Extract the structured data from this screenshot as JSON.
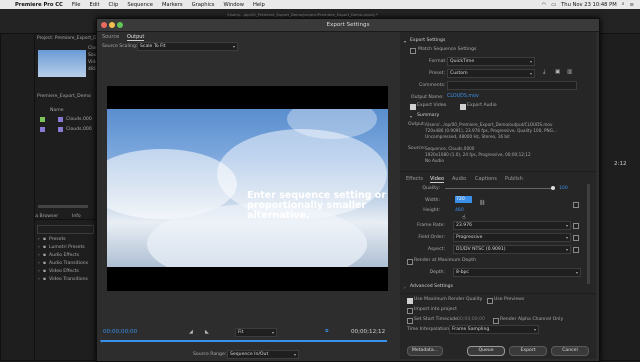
{
  "menubar": {
    "app": "Premiere Pro CC",
    "items": [
      "File",
      "Edit",
      "Clip",
      "Sequence",
      "Markers",
      "Graphics",
      "Window",
      "Help"
    ],
    "clock": "Thu Nov 23  10:48 PM"
  },
  "background_app": {
    "project_label": "Project: Premiere_Export_Demo",
    "clip_name": "Clouds",
    "clip_meta_1": "Sourc",
    "clip_meta_2": "Video",
    "clip_meta_3": "480",
    "project_file": "Premiere_Export_Demo",
    "name_header": "Name",
    "item1": "Clouds.000",
    "item2": "Clouds.000",
    "effects_tabs": [
      "ia Browser",
      "Info"
    ],
    "effects_items": [
      "Presets",
      "Lumetri Presets",
      "Audio Effects",
      "Audio Transitions",
      "Video Effects",
      "Video Transitions"
    ],
    "right_time": "2:12"
  },
  "dialog": {
    "title": "Export Settings",
    "path_hint": "/Users/...Jop/00_Premiere_Export_Demo/project/Premiere_Export_Demo.prproj *",
    "source_tab": "Source",
    "output_tab": "Output",
    "source_scaling_label": "Source Scaling:",
    "source_scaling_value": "Scale To Fit",
    "overlay_text": "Enter sequence setting or proportionally smaller alternative.",
    "timecode_start": "00;00;00;00",
    "timecode_end": "00;00;12;12",
    "fit_label": "Fit",
    "source_range_label": "Source Range:",
    "source_range_value": "Sequence In/Out",
    "metadata_button": "Metadata...",
    "queue_button": "Queue",
    "export_button": "Export",
    "cancel_button": "Cancel"
  },
  "export_settings": {
    "header": "Export Settings",
    "match_sequence": "Match Sequence Settings",
    "format_label": "Format:",
    "format_value": "QuickTime",
    "preset_label": "Preset:",
    "preset_value": "Custom",
    "comments_label": "Comments:",
    "output_name_label": "Output Name:",
    "output_name_value": "CLOUDS.mov",
    "export_video": "Export Video",
    "export_audio": "Export Audio",
    "summary_header": "Summary",
    "output_label": "Output:",
    "output_lines": [
      "/Users/.../op/00_Premiere_Export_Demo/output/CLOUDS.mov",
      "720x480 (0.9091), 23.976 fps, Progressive, Quality 100, PNG...",
      "Uncompressed, 48000 Hz, Stereo, 16 bit"
    ],
    "source_label": "Source:",
    "source_lines": [
      "Sequence, Clouds.0000",
      "1920x1080 (1.0), 24 fps, Progressive, 00;00;12;12",
      "No Audio"
    ]
  },
  "tabs": [
    "Effects",
    "Video",
    "Audio",
    "Captions",
    "Publish"
  ],
  "video": {
    "quality_label": "Quality:",
    "quality_value": "100",
    "width_label": "Width:",
    "width_value": "720",
    "height_label": "Height:",
    "height_value": "480",
    "frame_rate_label": "Frame Rate:",
    "frame_rate_value": "23.976",
    "field_order_label": "Field Order:",
    "field_order_value": "Progressive",
    "aspect_label": "Aspect:",
    "aspect_value": "D1/DV NTSC (0.9091)",
    "render_max_depth": "Render at Maximum Depth",
    "depth_label": "Depth:",
    "depth_value": "8-bpc"
  },
  "advanced": {
    "header": "Advanced Settings",
    "use_max_quality": "Use Maximum Render Quality",
    "use_previews": "Use Previews",
    "import_into_project": "Import into project",
    "set_start_timecode": "Set Start Timecode",
    "start_timecode_value": "00;00;00;00",
    "render_alpha": "Render Alpha Channel Only",
    "time_interp_label": "Time Interpolation:",
    "time_interp_value": "Frame Sampling"
  },
  "colors": {
    "accent": "#3a8fe8",
    "dialog_bg": "#2d2d2d",
    "sky_top": "#5a8ecf"
  }
}
